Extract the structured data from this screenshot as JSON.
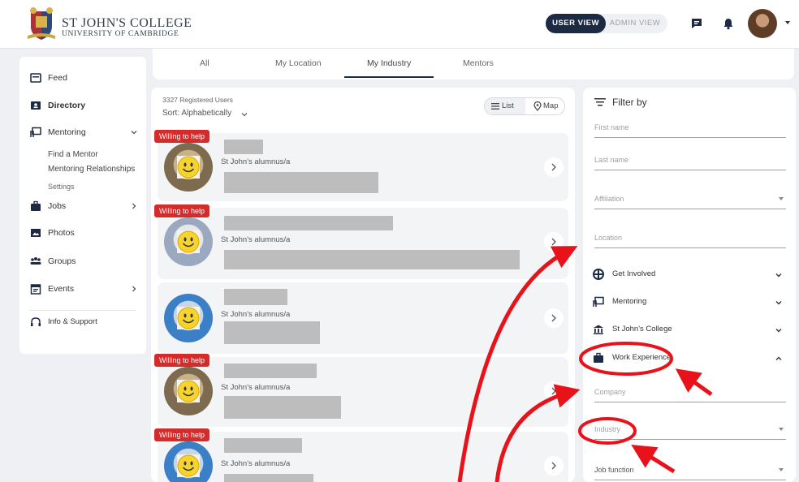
{
  "header": {
    "logo_title": "ST JOHN'S COLLEGE",
    "logo_subtitle": "UNIVERSITY OF CAMBRIDGE",
    "user_view_label": "USER VIEW",
    "admin_view_label": "ADMIN VIEW"
  },
  "sidebar": {
    "items": [
      {
        "label": "Feed",
        "icon": "feed-icon"
      },
      {
        "label": "Directory",
        "icon": "directory-icon"
      },
      {
        "label": "Mentoring",
        "icon": "mentoring-icon"
      },
      {
        "label": "Jobs",
        "icon": "briefcase-icon"
      },
      {
        "label": "Photos",
        "icon": "photo-icon"
      },
      {
        "label": "Groups",
        "icon": "groups-icon"
      },
      {
        "label": "Events",
        "icon": "calendar-icon"
      },
      {
        "label": "Info & Support",
        "icon": "support-icon"
      }
    ],
    "mentoring_sub": [
      "Find a Mentor",
      "Mentoring Relationships",
      "Settings"
    ]
  },
  "tabs": [
    "All",
    "My Location",
    "My Industry",
    "Mentors"
  ],
  "active_tab": "My Industry",
  "list": {
    "registered": "3327 Registered Users",
    "sort_label": "Sort:",
    "sort_value": "Alphabetically",
    "list_label": "List",
    "map_label": "Map",
    "badge_text": "Willing to help",
    "alumni_text": "St John's alumnus/a"
  },
  "filter": {
    "title": "Filter by",
    "fields": [
      "First name",
      "Last name",
      "Affiliation",
      "Location"
    ],
    "sections": [
      "Get Involved",
      "Mentoring",
      "St John's College",
      "Work Experience"
    ],
    "work_fields": [
      "Company",
      "Industry",
      "Job function"
    ]
  },
  "colors": {
    "accent_navy": "#1c2a44",
    "badge_red": "#d52b2b",
    "annotation_red": "#e8121b"
  }
}
